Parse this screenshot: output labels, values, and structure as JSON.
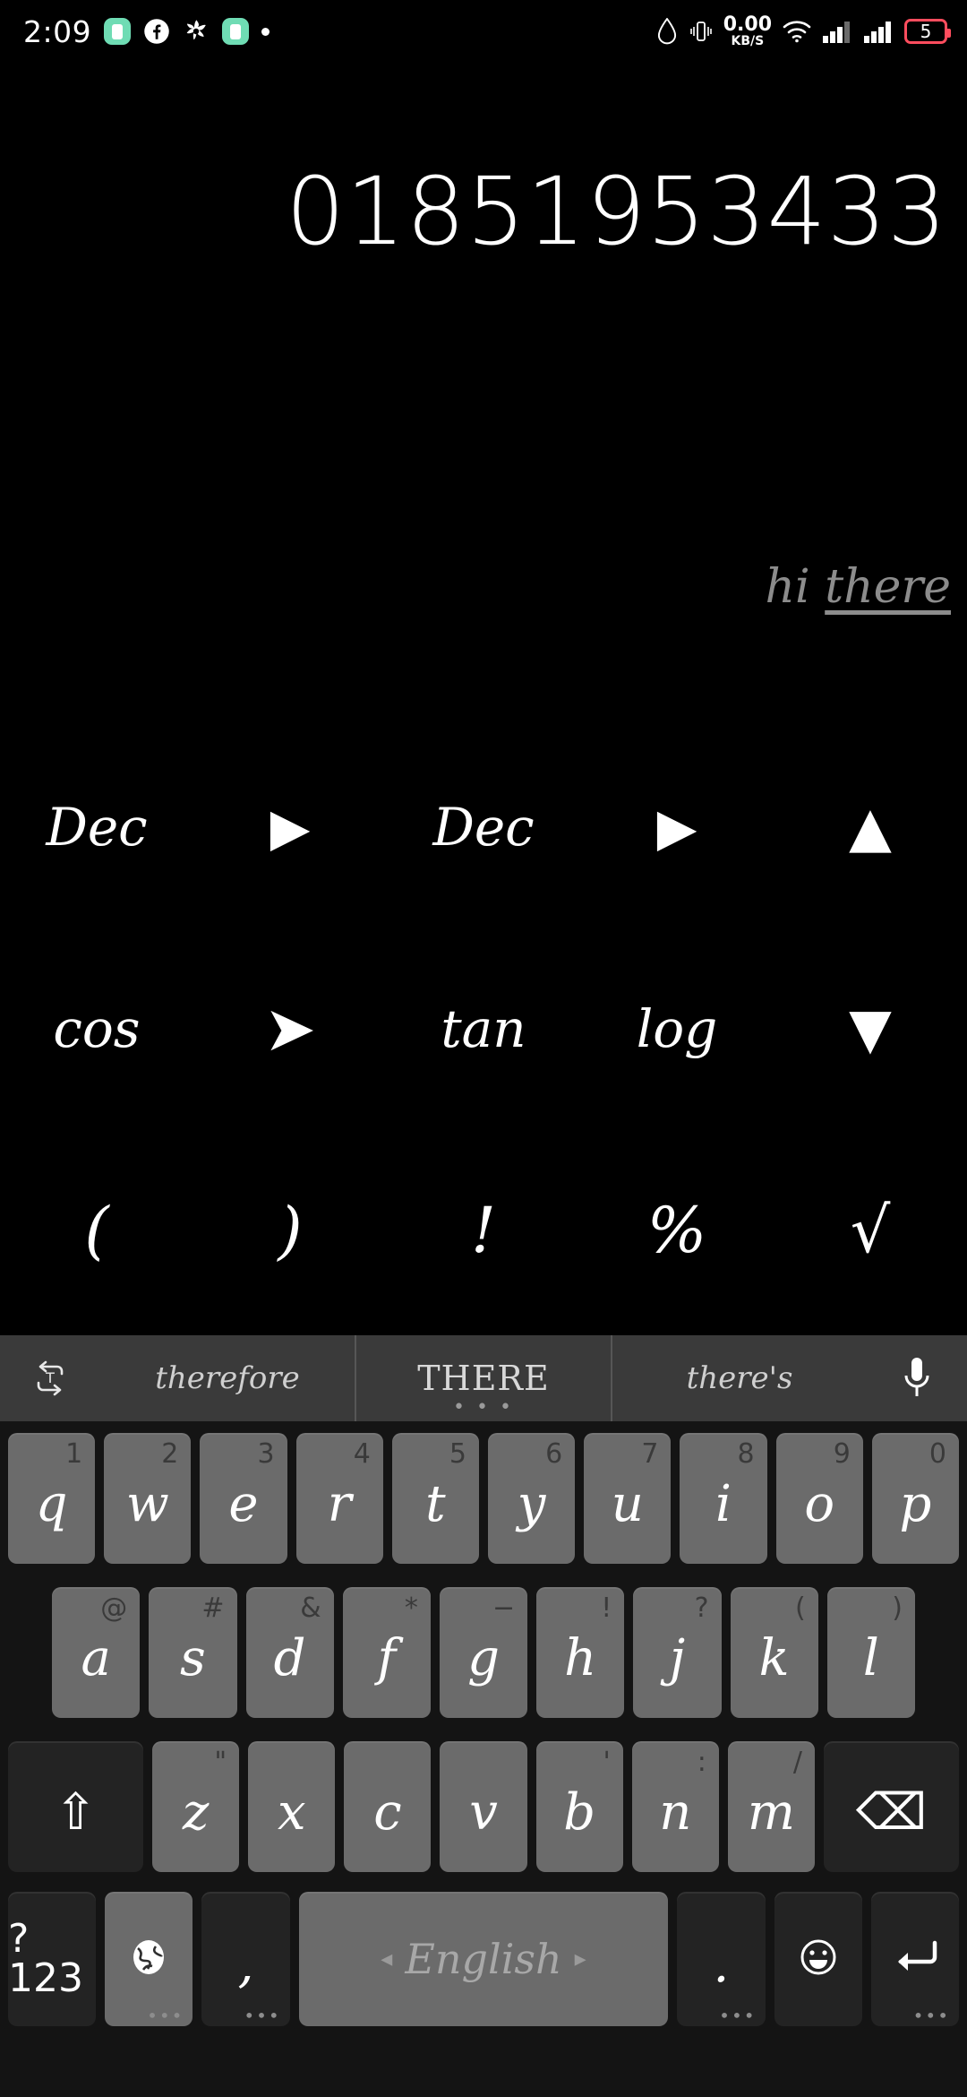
{
  "status_bar": {
    "time": "2:09",
    "left_icons": [
      "app-green-icon",
      "facebook-icon",
      "settings-flower-icon",
      "app-green-list-icon",
      "dot-icon"
    ],
    "network_speed_value": "0.00",
    "network_speed_unit": "KB/S",
    "right_icons": [
      "water-drop-icon",
      "vibrate-icon",
      "wifi-icon",
      "signal-1-icon",
      "signal-2-icon"
    ],
    "battery_level": "5",
    "battery_color": "#ff4d5e"
  },
  "calculator": {
    "expression": "01851953433",
    "hint_prefix": "hi ",
    "hint_word": "there",
    "hint_color": "#8c8c8c",
    "rows": [
      [
        {
          "label": "Dec",
          "name": "dec-left-key",
          "style": "text"
        },
        {
          "label": "▶",
          "name": "arrow-right-1-key",
          "style": "sym"
        },
        {
          "label": "Dec",
          "name": "dec-right-key",
          "style": "text"
        },
        {
          "label": "▶",
          "name": "arrow-right-2-key",
          "style": "sym"
        },
        {
          "label": "▲",
          "name": "arrow-up-key",
          "style": "tri"
        }
      ],
      [
        {
          "label": "cos",
          "name": "cos-key",
          "style": "text"
        },
        {
          "label": "➤",
          "name": "arrow-forward-key",
          "style": "sym"
        },
        {
          "label": "tan",
          "name": "tan-key",
          "style": "text"
        },
        {
          "label": "log",
          "name": "log-key",
          "style": "text"
        },
        {
          "label": "▼",
          "name": "arrow-down-key",
          "style": "tri"
        }
      ],
      [
        {
          "label": "(",
          "name": "paren-open-key",
          "style": "big"
        },
        {
          "label": ")",
          "name": "paren-close-key",
          "style": "big"
        },
        {
          "label": "!",
          "name": "factorial-key",
          "style": "big"
        },
        {
          "label": "%",
          "name": "percent-key",
          "style": "big"
        },
        {
          "label": "√",
          "name": "sqrt-key",
          "style": "big"
        }
      ]
    ]
  },
  "keyboard": {
    "suggestions": {
      "translate_icon": "translate-icon",
      "items": [
        {
          "text": "therefore",
          "name": "suggestion-therefore",
          "center": false
        },
        {
          "text": "THERE",
          "name": "suggestion-there",
          "center": true,
          "dots": "• • •"
        },
        {
          "text": "there's",
          "name": "suggestion-theres",
          "center": false
        }
      ],
      "mic_icon": "microphone-icon"
    },
    "row1": [
      {
        "key": "q",
        "hint": "1"
      },
      {
        "key": "w",
        "hint": "2"
      },
      {
        "key": "e",
        "hint": "3"
      },
      {
        "key": "r",
        "hint": "4"
      },
      {
        "key": "t",
        "hint": "5"
      },
      {
        "key": "y",
        "hint": "6"
      },
      {
        "key": "u",
        "hint": "7"
      },
      {
        "key": "i",
        "hint": "8"
      },
      {
        "key": "o",
        "hint": "9"
      },
      {
        "key": "p",
        "hint": "0"
      }
    ],
    "row2": [
      {
        "key": "a",
        "hint": "@"
      },
      {
        "key": "s",
        "hint": "#"
      },
      {
        "key": "d",
        "hint": "&"
      },
      {
        "key": "f",
        "hint": "*"
      },
      {
        "key": "g",
        "hint": "−"
      },
      {
        "key": "h",
        "hint": "!"
      },
      {
        "key": "j",
        "hint": "?"
      },
      {
        "key": "k",
        "hint": "("
      },
      {
        "key": "l",
        "hint": ")"
      }
    ],
    "row3": {
      "shift_label": "⇧",
      "shift_name": "shift-key",
      "keys": [
        {
          "key": "z",
          "hint": "\""
        },
        {
          "key": "x",
          "hint": ""
        },
        {
          "key": "c",
          "hint": ""
        },
        {
          "key": "v",
          "hint": ""
        },
        {
          "key": "b",
          "hint": "'"
        },
        {
          "key": "n",
          "hint": ":"
        },
        {
          "key": "m",
          "hint": "/"
        }
      ],
      "backspace_label": "⌫",
      "backspace_name": "backspace-key"
    },
    "row4": {
      "symbols_label": "?123",
      "globe_label": "🌐",
      "comma_label": ",",
      "space_label": "English",
      "space_arrow_left": "◂",
      "space_arrow_right": "▸",
      "period_label": ".",
      "emoji_label": "☺",
      "enter_label": "↵",
      "dots": "•••"
    }
  }
}
